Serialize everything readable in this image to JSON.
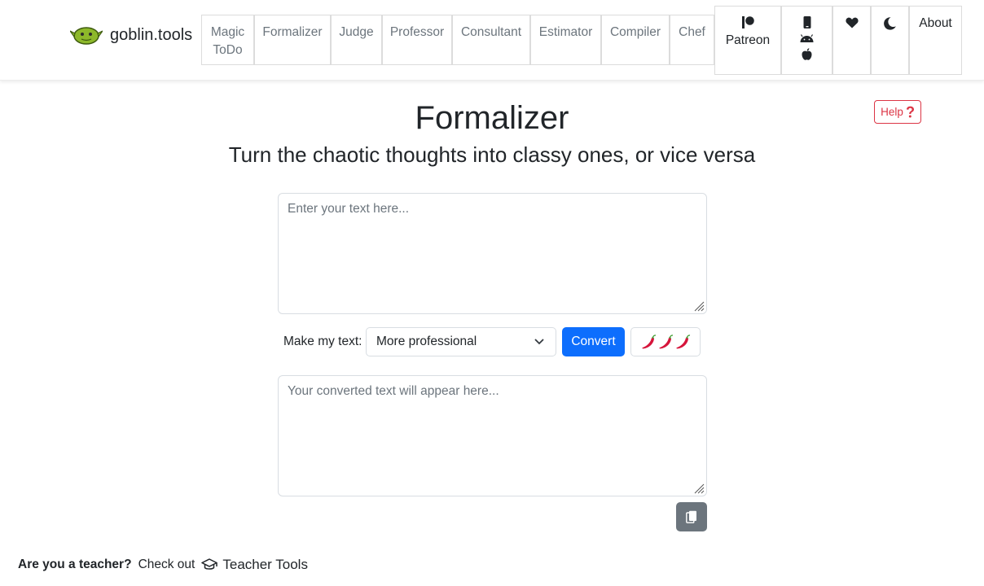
{
  "brand": {
    "name": "goblin.tools",
    "logo_icon": "goblin-logo-icon"
  },
  "nav": {
    "tools": [
      "Magic\nToDo",
      "Formalizer",
      "Judge",
      "Professor",
      "Consultant",
      "Estimator",
      "Compiler",
      "Chef"
    ],
    "patreon": "Patreon",
    "about": "About",
    "icons": [
      "patreon-icon",
      "mobile-icon",
      "android-icon",
      "apple-icon",
      "heart-icon",
      "moon-icon"
    ]
  },
  "help": {
    "label": "Help",
    "icon": "question-icon"
  },
  "page": {
    "title": "Formalizer",
    "subtitle": "Turn the chaotic thoughts into classy ones, or vice versa"
  },
  "input": {
    "placeholder": "Enter your text here..."
  },
  "controls": {
    "label": "Make my text:",
    "selected": "More professional",
    "convert": "Convert",
    "spice_icon": "chili-pepper-icon",
    "spice_count": 3
  },
  "output": {
    "placeholder": "Your converted text will appear here..."
  },
  "copy": {
    "icon": "copy-icon"
  },
  "footer": {
    "question": "Are you a teacher?",
    "checkout": "Check out",
    "link": "Teacher Tools",
    "icon": "graduation-cap-icon"
  },
  "colors": {
    "primary": "#0d6efd",
    "danger": "#dc3545",
    "secondary": "#6c757d",
    "goblin_green": "#8db82a"
  }
}
